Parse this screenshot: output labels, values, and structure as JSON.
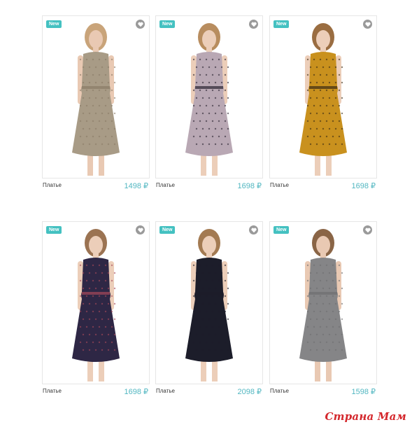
{
  "products": [
    {
      "badge": "New",
      "name": "Платье",
      "price": "1498 ₽",
      "dress_color": "#a89b86",
      "pattern": "#8a7c67",
      "hair": "#c9a47a",
      "skin": "#e9c9b3"
    },
    {
      "badge": "New",
      "name": "Платье",
      "price": "1698 ₽",
      "dress_color": "#b9a8b4",
      "pattern": "#2a2330",
      "hair": "#b88d5f",
      "skin": "#ecceb9"
    },
    {
      "badge": "New",
      "name": "Платье",
      "price": "1698 ₽",
      "dress_color": "#c9911e",
      "pattern": "#3a2b14",
      "hair": "#9a6d41",
      "skin": "#ecceb9"
    },
    {
      "badge": "New",
      "name": "Платье",
      "price": "1698 ₽",
      "dress_color": "#2e2745",
      "pattern": "#a7495a",
      "hair": "#9b7352",
      "skin": "#ecceb9"
    },
    {
      "badge": "New",
      "name": "Платье",
      "price": "2098 ₽",
      "dress_color": "#1c1d2a",
      "pattern": "#1c1d2a",
      "hair": "#a37a52",
      "skin": "#ecceb9"
    },
    {
      "badge": "New",
      "name": "Платье",
      "price": "1598 ₽",
      "dress_color": "#858587",
      "pattern": "#6e6e70",
      "hair": "#8a6546",
      "skin": "#e9c9b3"
    }
  ],
  "watermark": "Страна Мам",
  "colors": {
    "badge": "#44c1c1",
    "price": "#52b7c1",
    "watermark": "#d4272c"
  }
}
